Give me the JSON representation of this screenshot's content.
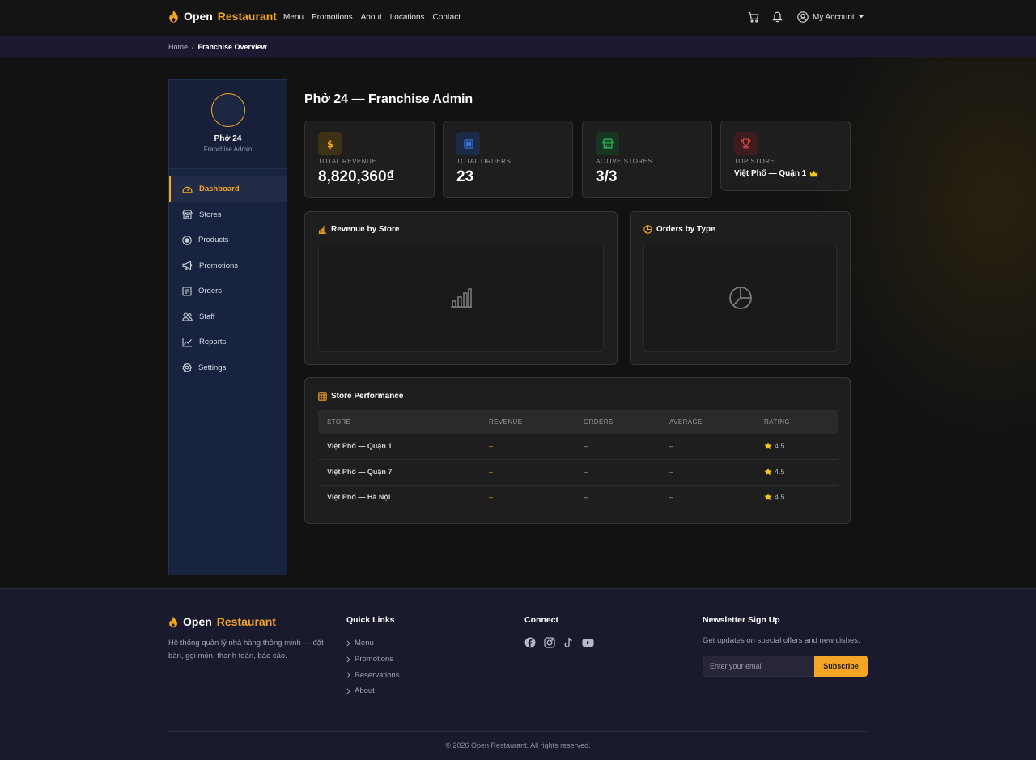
{
  "brand": {
    "word1": "Open",
    "word2": "Restaurant"
  },
  "nav": [
    "Menu",
    "Promotions",
    "About",
    "Locations",
    "Contact"
  ],
  "account_label": "My Account",
  "breadcrumb": {
    "home": "Home",
    "separator": "/",
    "current": "Franchise Overview"
  },
  "sidebar": {
    "name": "Phở 24",
    "role": "Franchise Admin",
    "items": [
      {
        "label": "Dashboard",
        "icon": "gauge-icon",
        "active": true
      },
      {
        "label": "Stores",
        "icon": "store-icon"
      },
      {
        "label": "Products",
        "icon": "product-icon"
      },
      {
        "label": "Promotions",
        "icon": "megaphone-icon"
      },
      {
        "label": "Orders",
        "icon": "receipt-icon"
      },
      {
        "label": "Staff",
        "icon": "people-icon"
      },
      {
        "label": "Reports",
        "icon": "line-chart-icon"
      },
      {
        "label": "Settings",
        "icon": "gear-icon"
      }
    ]
  },
  "page_title": "Phở 24 — Franchise Admin",
  "kpis": [
    {
      "label": "TOTAL REVENUE",
      "value": "8,820,360₫",
      "icon": "dollar-icon",
      "color": "#f5a524"
    },
    {
      "label": "TOTAL ORDERS",
      "value": "23",
      "icon": "order-icon",
      "color": "#3b6fd8"
    },
    {
      "label": "ACTIVE STORES",
      "value": "3/3",
      "icon": "store-icon",
      "color": "#2fbf5b"
    },
    {
      "label": "TOP STORE",
      "value": "Việt Phố — Quận 1",
      "icon": "trophy-icon",
      "color": "#e04848"
    }
  ],
  "charts": {
    "revenue_title": "Revenue by Store",
    "orders_title": "Orders by Type"
  },
  "table": {
    "title": "Store Performance",
    "headers": [
      "STORE",
      "REVENUE",
      "ORDERS",
      "AVERAGE",
      "RATING"
    ],
    "rows": [
      {
        "store": "Việt Phố — Quận 1",
        "revenue": "–",
        "orders": "–",
        "average": "–",
        "rating": "4.5"
      },
      {
        "store": "Việt Phố — Quận 7",
        "revenue": "–",
        "orders": "–",
        "average": "–",
        "rating": "4.5"
      },
      {
        "store": "Việt Phố — Hà Nội",
        "revenue": "–",
        "orders": "–",
        "average": "–",
        "rating": "4.5"
      }
    ]
  },
  "footer": {
    "description": "Hệ thống quản lý nhà hàng thông minh — đặt bàn, gọi món, thanh toán, báo cáo.",
    "quick_links_title": "Quick Links",
    "quick_links": [
      "Menu",
      "Promotions",
      "Reservations",
      "About"
    ],
    "connect_title": "Connect",
    "newsletter_title": "Newsletter Sign Up",
    "newsletter_text": "Get updates on special offers and new dishes.",
    "email_placeholder": "Enter your email",
    "subscribe_label": "Subscribe",
    "copyright": "© 2026 Open Restaurant. All rights reserved."
  },
  "colors": {
    "accent": "#f5a524",
    "sidebar_bg": "#18233f",
    "footer_bg": "#1a1a2e"
  }
}
